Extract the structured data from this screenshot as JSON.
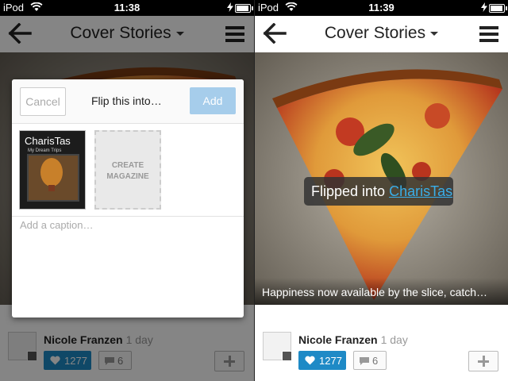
{
  "left": {
    "status": {
      "carrier": "iPod",
      "time": "11:38"
    },
    "nav": {
      "title": "Cover Stories"
    },
    "dialog": {
      "cancel_label": "Cancel",
      "title": "Flip this into…",
      "add_label": "Add",
      "magazine": {
        "name": "CharisTas",
        "subtitle": "My Dream Trips"
      },
      "create_label": "CREATE MAGAZINE",
      "caption_placeholder": "Add a caption…"
    },
    "author": {
      "name": "Nicole Franzen",
      "age": "1 day"
    },
    "likes": "1277",
    "comments": "6"
  },
  "right": {
    "status": {
      "carrier": "iPod",
      "time": "11:39"
    },
    "nav": {
      "title": "Cover Stories"
    },
    "toast": {
      "prefix": "Flipped into",
      "link": "CharisTas"
    },
    "photo_caption": "Happiness now available by the slice, catch…",
    "author": {
      "name": "Nicole Franzen",
      "age": "1 day"
    },
    "likes": "1277",
    "comments": "6"
  },
  "icons": [
    "wifi-icon",
    "battery-icon",
    "back-arrow-icon",
    "dropdown-caret-icon",
    "menu-icon",
    "heart-icon",
    "comment-icon",
    "plus-icon",
    "camera-icon"
  ],
  "colors": {
    "like_blue": "#1e8ac6",
    "add_button": "#a6cdeb",
    "link": "#39aee8"
  }
}
